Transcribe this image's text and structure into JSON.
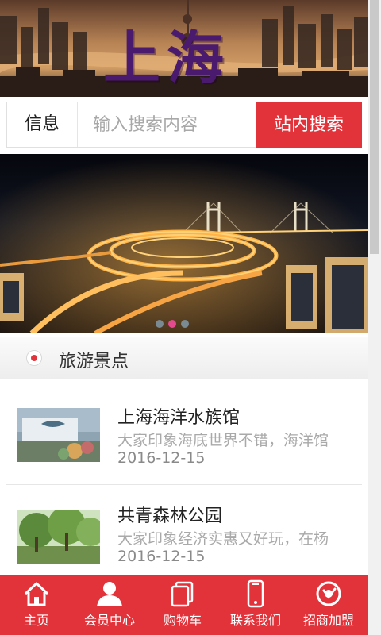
{
  "header": {
    "title": "上海"
  },
  "search": {
    "category": "信息",
    "placeholder": "输入搜索内容",
    "button": "站内搜索"
  },
  "slider": {
    "dots": 3,
    "active_index": 1
  },
  "section": {
    "title": "旅游景点"
  },
  "items": [
    {
      "title": "上海海洋水族馆",
      "desc": "大家印象海底世界不错，海洋馆",
      "date": "2016-12-15"
    },
    {
      "title": "共青森林公园",
      "desc": "大家印象经济实惠又好玩，在杨",
      "date": "2016-12-15"
    }
  ],
  "nav": [
    {
      "label": "主页",
      "icon": "home-icon"
    },
    {
      "label": "会员中心",
      "icon": "user-icon"
    },
    {
      "label": "购物车",
      "icon": "cart-icon"
    },
    {
      "label": "联系我们",
      "icon": "phone-icon"
    },
    {
      "label": "招商加盟",
      "icon": "handshake-icon"
    }
  ],
  "colors": {
    "accent": "#e2333b",
    "section_bg": "#efefef"
  }
}
